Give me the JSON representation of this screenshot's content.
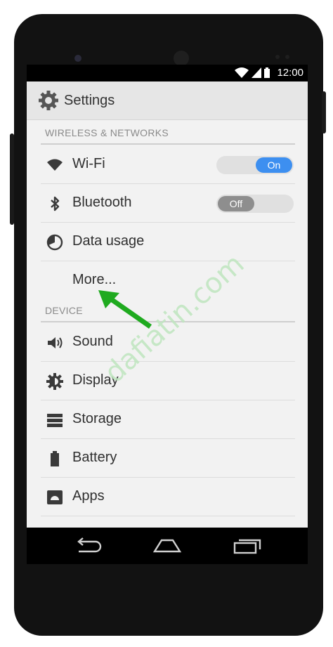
{
  "status_bar": {
    "time": "12:00"
  },
  "action_bar": {
    "title": "Settings"
  },
  "sections": {
    "wireless": "WIRELESS & NETWORKS",
    "device": "DEVICE"
  },
  "wifi": {
    "label": "Wi-Fi",
    "toggle": "On"
  },
  "bluetooth": {
    "label": "Bluetooth",
    "toggle": "Off"
  },
  "data_usage": {
    "label": "Data usage"
  },
  "more": {
    "label": "More..."
  },
  "sound": {
    "label": "Sound"
  },
  "display": {
    "label": "Display"
  },
  "storage": {
    "label": "Storage"
  },
  "battery": {
    "label": "Battery"
  },
  "apps": {
    "label": "Apps"
  },
  "watermark": "dafiatin.com",
  "colors": {
    "toggle_on": "#3d8ff0",
    "toggle_off": "#8e8e8e",
    "arrow": "#1faa1f"
  },
  "icons": [
    "wifi-icon",
    "bluetooth-icon",
    "data-usage-icon",
    "sound-icon",
    "display-icon",
    "storage-icon",
    "battery-icon",
    "apps-icon",
    "gear-icon",
    "back-icon",
    "home-icon",
    "recents-icon"
  ]
}
